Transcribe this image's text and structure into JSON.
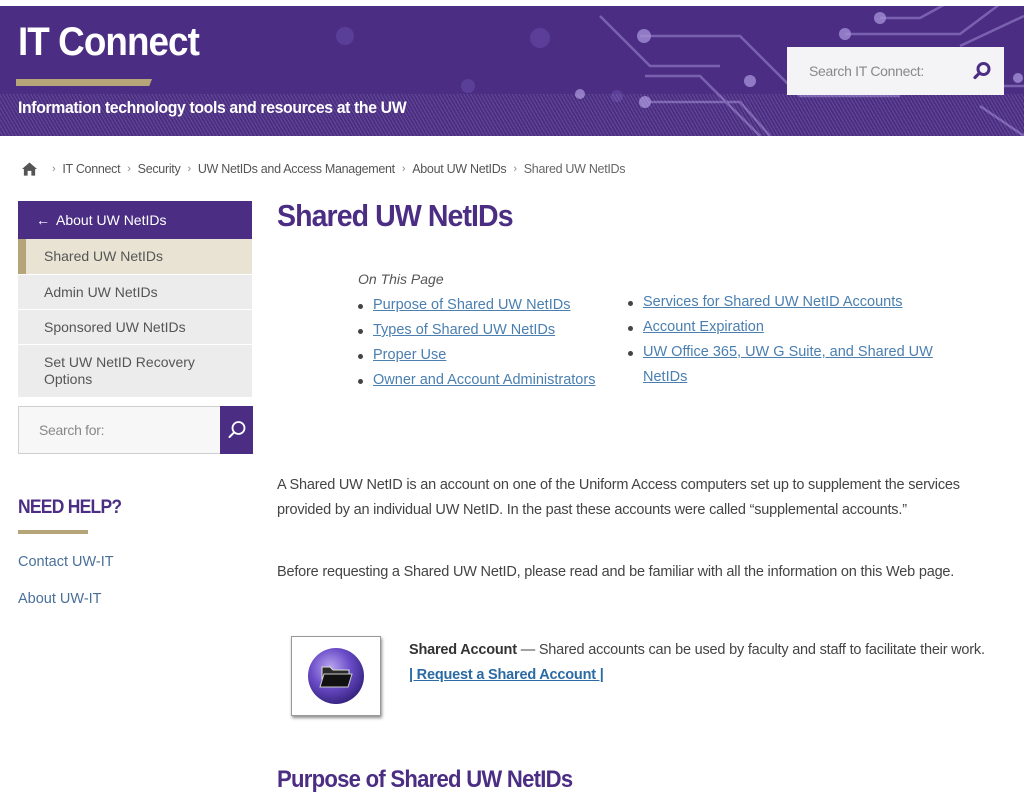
{
  "header": {
    "site_title": "IT Connect",
    "tagline": "Information technology tools and resources at the UW",
    "search_placeholder": "Search IT Connect:",
    "brand_color": "#4b2e83",
    "accent_color": "#b7a57a"
  },
  "breadcrumb": {
    "items": [
      "IT Connect",
      "Security",
      "UW NetIDs and Access Management",
      "About UW NetIDs"
    ],
    "current": "Shared UW NetIDs",
    "separator": "›"
  },
  "sidebar": {
    "parent_label": "About UW NetIDs",
    "parent_arrow": "←",
    "items": [
      {
        "label": "Shared UW NetIDs",
        "active": true
      },
      {
        "label": "Admin UW NetIDs",
        "active": false
      },
      {
        "label": "Sponsored UW NetIDs",
        "active": false
      },
      {
        "label": "Set UW NetID Recovery Options",
        "active": false
      }
    ],
    "search_placeholder": "Search for:",
    "help_heading": "NEED HELP?",
    "help_links": [
      "Contact UW-IT",
      "About UW-IT"
    ]
  },
  "main": {
    "title": "Shared UW NetIDs",
    "toc": {
      "label": "On This Page",
      "left": [
        "Purpose of Shared UW NetIDs",
        "Types of Shared UW NetIDs",
        "Proper Use",
        "Owner and Account Administrators"
      ],
      "right": [
        "Services for Shared UW NetID Accounts",
        "Account Expiration",
        "UW Office 365, UW G Suite, and Shared UW NetIDs"
      ]
    },
    "paragraphs": [
      "A Shared UW NetID is an account on one of the Uniform Access computers set up to supplement the services provided by an individual UW NetID. In the past these accounts were called “supplemental accounts.”",
      "Before requesting a Shared UW NetID, please read and be familiar with all the information on this Web page."
    ],
    "feature": {
      "title": "Shared Account",
      "dash": " — ",
      "description": "Shared accounts can be used by faculty and staff to facilitate their work.",
      "link_label": "| Request a Shared Account |",
      "icon": "folder-icon"
    },
    "section_heading": "Purpose of Shared UW NetIDs"
  }
}
